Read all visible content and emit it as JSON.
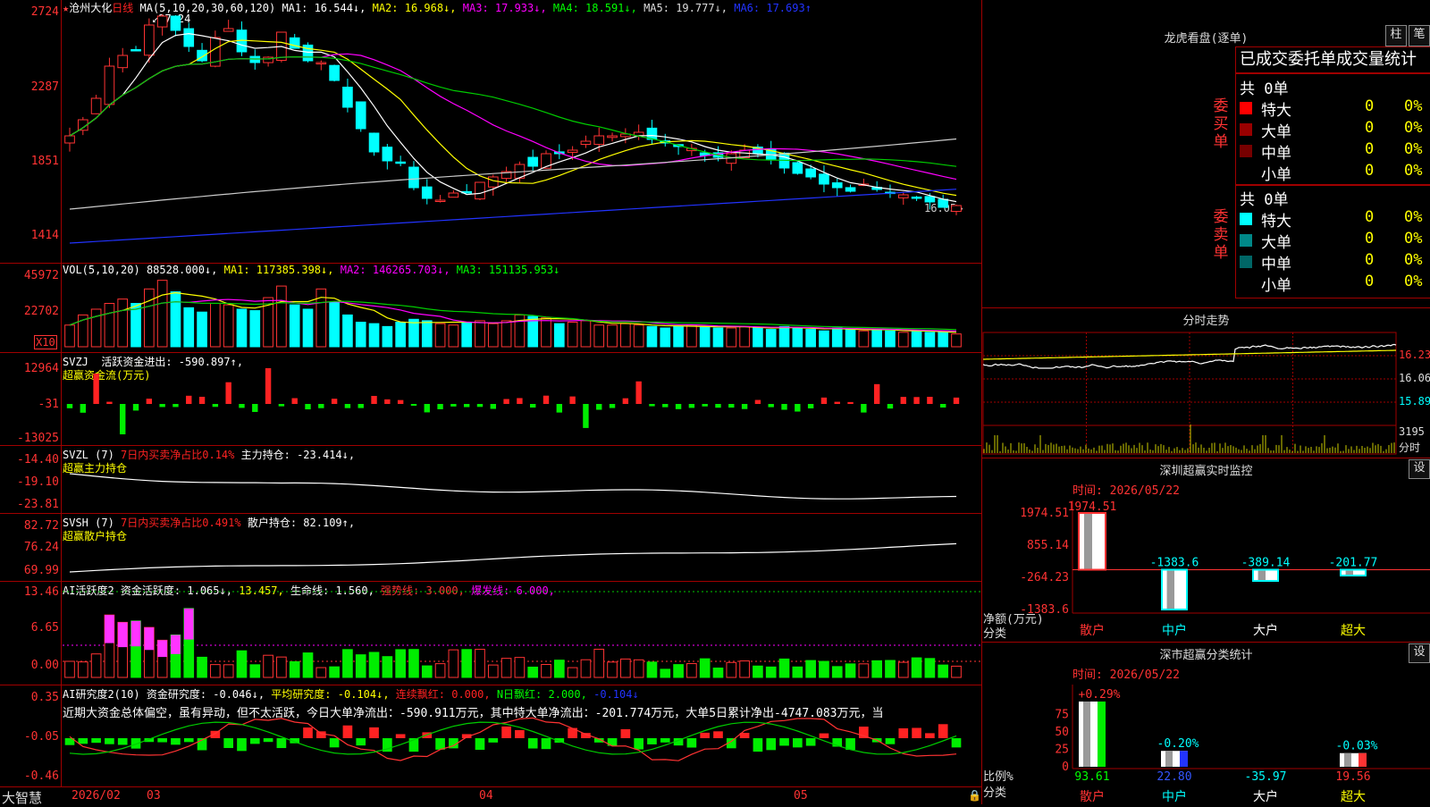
{
  "kline": {
    "title": "沧州大化",
    "period": "日线",
    "ma_label": "MA(5,10,20,30,60,120)",
    "ma1": "MA1: 16.544↓,",
    "ma2": "MA2: 16.968↓,",
    "ma3": "MA3: 17.933↓,",
    "ma4": "MA4: 18.591↓,",
    "ma5": "MA5: 19.777↓,",
    "ma6": "MA6: 17.693↑",
    "high_mark": "27.24",
    "low_mark": "16.05",
    "y_ticks": [
      "2724",
      "2287",
      "1851",
      "1414"
    ]
  },
  "vol": {
    "label": "VOL(5,10,20)",
    "v": "88528.000↓,",
    "ma1": "MA1: 117385.398↓,",
    "ma2": "MA2: 146265.703↓,",
    "ma3": "MA3: 151135.953↓",
    "y_ticks": [
      "45972",
      "22702"
    ],
    "unit": "X10"
  },
  "svzj": {
    "label": "SVZJ",
    "text": "活跃资金进出: -590.897↑,",
    "sub": "超赢资金流(万元)",
    "y_ticks": [
      "12964",
      "-31",
      "-13025"
    ]
  },
  "svzl": {
    "label": "SVZL (7)",
    "t1": "7日内买卖净占比0.14%",
    "t2": "主力持仓: -23.414↓,",
    "sub": "超赢主力持仓",
    "y_ticks": [
      "-14.40",
      "-19.10",
      "-23.81"
    ]
  },
  "svsh": {
    "label": "SVSH (7)",
    "t1": "7日内买卖净占比0.491%",
    "t2": "散户持仓: 82.109↑,",
    "sub": "超赢散户持仓",
    "y_ticks": [
      "82.72",
      "76.24",
      "69.99"
    ]
  },
  "ai1": {
    "label": "AI活跃度2",
    "t1": "资金活跃度: 1.065↓,",
    "t2": "13.457,",
    "t3": "生命线: 1.560,",
    "t4": "强势线: 3.000,",
    "t5": "爆发线: 6.000,",
    "y_ticks": [
      "13.46",
      "6.65",
      "0.00"
    ]
  },
  "ai2": {
    "label": "AI研究度2(10)",
    "t1": "资金研究度: -0.046↓,",
    "t2": "平均研究度: -0.104↓,",
    "t3": "连续飘红: 0.000,",
    "t4": "N日飘红: 2.000,",
    "t5": "-0.104↓",
    "commentary": "近期大资金总体偏空，虽有异动，但不太活跃，今日大单净流出：-590.911万元，其中特大单净流出：-201.774万元，大单5日累计净出-4747.083万元，当",
    "y_ticks": [
      "0.35",
      "-0.05",
      "-0.46"
    ]
  },
  "xaxis": {
    "brand": "大智慧",
    "labels": [
      "2026/02",
      "03",
      "04",
      "05"
    ]
  },
  "dragon": {
    "title": "龙虎看盘(逐单)",
    "btn1": "柱",
    "btn2": "笔",
    "header": "已成交委托单成交量统计",
    "buy_label": "委买单",
    "sell_label": "委卖单",
    "buy_total": "共 0单",
    "sell_total": "共 0单",
    "rows": [
      "特大",
      "大单",
      "中单",
      "小单"
    ],
    "val": "0",
    "pct": "0%"
  },
  "intraday": {
    "title": "分时走势",
    "y_ticks": [
      "16.23",
      "16.06",
      "15.89"
    ],
    "vol_tick": "3195",
    "vol_label": "分时"
  },
  "monitor": {
    "title": "深圳超赢实时监控",
    "set": "设",
    "time": "时间: 2026/05/22",
    "y_ticks": [
      "1974.51",
      "855.14",
      "-264.23",
      "-1383.6"
    ],
    "ylabel": "净额(万元)",
    "xlabel": "分类",
    "categories": [
      "散户",
      "中户",
      "大户",
      "超大"
    ],
    "values": [
      1974.51,
      -1383.6,
      -389.14,
      -201.77
    ],
    "value_labels": [
      "1974.51",
      "-1383.6",
      "-389.14",
      "-201.77"
    ]
  },
  "classify": {
    "title": "深市超赢分类统计",
    "set": "设",
    "time": "时间: 2026/05/22",
    "y_ticks": [
      "75",
      "50",
      "25",
      "0"
    ],
    "ylabel": "比例%",
    "xlabel": "分类",
    "categories": [
      "散户",
      "中户",
      "大户",
      "超大"
    ],
    "top_labels": [
      "+0.29%",
      "-0.20%",
      "",
      "-0.03%"
    ],
    "bottom_labels": [
      "93.61",
      "22.80",
      "-35.97",
      "19.56"
    ],
    "bar_heights": [
      93.61,
      22.8,
      0,
      19.56
    ]
  },
  "chart_data": {
    "type": "candlestick",
    "title": "沧州大化 日线",
    "y_axis_ticks": [
      27.24,
      22.87,
      18.51,
      14.14
    ],
    "ylim": [
      13.6,
      27.6
    ],
    "close": [
      20.3,
      21.2,
      22.4,
      24.2,
      24.8,
      25.1,
      26.5,
      27.0,
      26.2,
      25.3,
      24.5,
      25.8,
      26.3,
      25.0,
      24.4,
      24.7,
      26.1,
      25.2,
      24.5,
      24.4,
      23.4,
      21.9,
      20.7,
      19.4,
      18.9,
      18.8,
      17.4,
      16.8,
      16.7,
      17.1,
      17.1,
      17.7,
      18.0,
      18.3,
      18.7,
      18.6,
      19.3,
      19.3,
      19.5,
      20.0,
      20.3,
      20.3,
      20.4,
      20.5,
      20.1,
      19.9,
      19.7,
      19.6,
      19.2,
      19.1,
      19.3,
      19.5,
      19.3,
      19.0,
      18.5,
      18.2,
      18.0,
      17.6,
      17.4,
      17.2,
      17.6,
      17.3,
      17.1,
      17.0,
      16.8,
      16.6,
      16.3,
      16.4
    ],
    "volume_x10": [
      15000,
      22000,
      26000,
      30000,
      33000,
      30000,
      40000,
      45972,
      38000,
      27000,
      24000,
      30000,
      29000,
      26000,
      25000,
      34000,
      42000,
      29000,
      26000,
      40000,
      31000,
      22000,
      17000,
      16000,
      14000,
      17000,
      19000,
      18000,
      16000,
      15000,
      17000,
      18000,
      16000,
      18000,
      22000,
      21000,
      20000,
      16000,
      17000,
      18000,
      15000,
      15000,
      16000,
      15000,
      14000,
      13000,
      14000,
      15000,
      14000,
      13000,
      13000,
      14000,
      13000,
      12000,
      14000,
      13000,
      12000,
      11000,
      13000,
      12000,
      11000,
      12000,
      11000,
      10000,
      11000,
      10000,
      10000,
      8852
    ]
  }
}
